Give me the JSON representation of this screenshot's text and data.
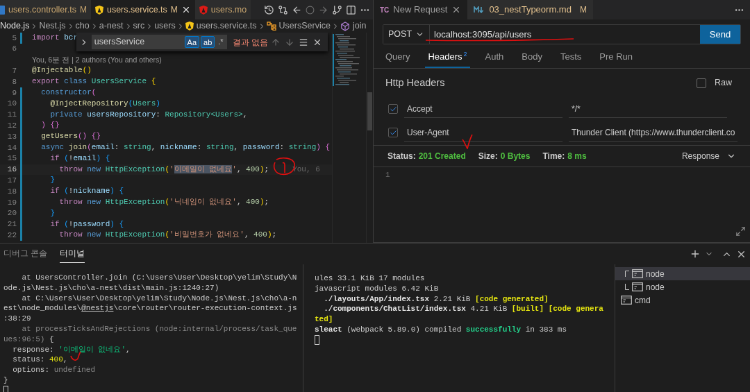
{
  "editor": {
    "tabs": [
      {
        "label": "users.controller.ts",
        "status": "M",
        "kind": "ts",
        "selected": false
      },
      {
        "label": "users.service.ts",
        "status": "M",
        "kind": "service",
        "selected": true
      },
      {
        "label": "users.mo",
        "kind": "module",
        "selected": false
      }
    ],
    "breadcrumb": [
      {
        "label": "Node.js",
        "kind": "folder"
      },
      {
        "label": "Nest.js",
        "kind": "folder"
      },
      {
        "label": "cho",
        "kind": "folder"
      },
      {
        "label": "a-nest",
        "kind": "folder"
      },
      {
        "label": "src",
        "kind": "folder"
      },
      {
        "label": "users",
        "kind": "folder"
      },
      {
        "label": "users.service.ts",
        "kind": "file"
      },
      {
        "label": "UsersService",
        "kind": "class"
      },
      {
        "label": "join",
        "kind": "method"
      }
    ],
    "find": {
      "value": "usersService",
      "toggles": [
        {
          "label": "Aa",
          "on": true
        },
        {
          "label": "ab",
          "on": true
        },
        {
          "label": ".*",
          "on": false
        }
      ],
      "result": "결과 없음"
    },
    "lines": [
      {
        "kind": "code",
        "number": "5",
        "modified": true,
        "current": false,
        "tokens": [
          {
            "text": "import ",
            "kind": "kw"
          },
          {
            "text": "bcr",
            "kind": "var"
          }
        ]
      },
      {
        "kind": "code",
        "number": "6",
        "modified": false,
        "current": false
      },
      {
        "kind": "codelens",
        "text": "You, 6분 전 | 2 authors (You and others)"
      },
      {
        "kind": "code",
        "number": "7",
        "modified": false,
        "current": false,
        "tokens": [
          {
            "text": "@Injectable",
            "kind": "fn"
          },
          {
            "text": "()",
            "kind": "b1"
          }
        ]
      },
      {
        "kind": "code",
        "number": "8",
        "modified": false,
        "current": false,
        "tokens": [
          {
            "text": "export ",
            "kind": "kw"
          },
          {
            "text": "class ",
            "kind": "storage"
          },
          {
            "text": "UsersService ",
            "kind": "type"
          },
          {
            "text": "{",
            "kind": "b1"
          }
        ]
      },
      {
        "kind": "code",
        "number": "9",
        "modified": true,
        "current": false,
        "tokens": [
          {
            "text": "  constructor",
            "kind": "storage"
          },
          {
            "text": "(",
            "kind": "b2"
          }
        ]
      },
      {
        "kind": "code",
        "number": "10",
        "modified": true,
        "current": false,
        "tokens": [
          {
            "text": "    @InjectRepository",
            "kind": "fn"
          },
          {
            "text": "(",
            "kind": "b3"
          },
          {
            "text": "Users",
            "kind": "type"
          },
          {
            "text": ")",
            "kind": "b3"
          }
        ]
      },
      {
        "kind": "code",
        "number": "11",
        "modified": true,
        "current": false,
        "tokens": [
          {
            "text": "    private ",
            "kind": "storage"
          },
          {
            "text": "usersRepository",
            "kind": "var"
          },
          {
            "text": ": ",
            "kind": "plain"
          },
          {
            "text": "Repository<Users>",
            "kind": "type"
          },
          {
            "text": ",",
            "kind": "plain"
          }
        ]
      },
      {
        "kind": "code",
        "number": "12",
        "modified": true,
        "current": false,
        "tokens": [
          {
            "text": "  ) {}",
            "kind": "b2"
          }
        ]
      },
      {
        "kind": "code",
        "number": "13",
        "modified": true,
        "current": false,
        "tokens": [
          {
            "text": "  getUsers",
            "kind": "fn"
          },
          {
            "text": "() {}",
            "kind": "b2"
          }
        ]
      },
      {
        "kind": "code",
        "number": "14",
        "modified": true,
        "current": false,
        "tokens": [
          {
            "text": "  async ",
            "kind": "storage"
          },
          {
            "text": "join",
            "kind": "fn"
          },
          {
            "text": "(",
            "kind": "b2"
          },
          {
            "text": "email",
            "kind": "var"
          },
          {
            "text": ": ",
            "kind": "plain"
          },
          {
            "text": "string",
            "kind": "type"
          },
          {
            "text": ", ",
            "kind": "plain"
          },
          {
            "text": "nickname",
            "kind": "var"
          },
          {
            "text": ": ",
            "kind": "plain"
          },
          {
            "text": "string",
            "kind": "type"
          },
          {
            "text": ", ",
            "kind": "plain"
          },
          {
            "text": "password",
            "kind": "var"
          },
          {
            "text": ": ",
            "kind": "plain"
          },
          {
            "text": "string",
            "kind": "type"
          },
          {
            "text": ") {",
            "kind": "b2"
          }
        ]
      },
      {
        "kind": "code",
        "number": "15",
        "modified": true,
        "current": false,
        "tokens": [
          {
            "text": "    if ",
            "kind": "kw"
          },
          {
            "text": "(",
            "kind": "b3"
          },
          {
            "text": "!",
            "kind": "plain"
          },
          {
            "text": "email",
            "kind": "var"
          },
          {
            "text": ") {",
            "kind": "b3"
          }
        ]
      },
      {
        "kind": "code",
        "number": "16",
        "modified": true,
        "current": true,
        "blame": "You, 6",
        "tokens": [
          {
            "text": "      throw ",
            "kind": "kw"
          },
          {
            "text": "new ",
            "kind": "storage"
          },
          {
            "text": "HttpException",
            "kind": "type"
          },
          {
            "text": "(",
            "kind": "b1"
          },
          {
            "text": "'",
            "kind": "str"
          },
          {
            "text": "이메일이 없네요",
            "kind": "match"
          },
          {
            "text": "'",
            "kind": "str"
          },
          {
            "text": ", ",
            "kind": "plain"
          },
          {
            "text": "400",
            "kind": "num"
          },
          {
            "text": ")",
            "kind": "b1"
          },
          {
            "text": ";",
            "kind": "plain"
          }
        ]
      },
      {
        "kind": "code",
        "number": "17",
        "modified": true,
        "current": false,
        "tokens": [
          {
            "text": "    }",
            "kind": "b3"
          }
        ]
      },
      {
        "kind": "code",
        "number": "18",
        "modified": true,
        "current": false,
        "tokens": [
          {
            "text": "    if ",
            "kind": "kw"
          },
          {
            "text": "(",
            "kind": "b3"
          },
          {
            "text": "!",
            "kind": "plain"
          },
          {
            "text": "nickname",
            "kind": "var"
          },
          {
            "text": ") {",
            "kind": "b3"
          }
        ]
      },
      {
        "kind": "code",
        "number": "19",
        "modified": true,
        "current": false,
        "tokens": [
          {
            "text": "      throw ",
            "kind": "kw"
          },
          {
            "text": "new ",
            "kind": "storage"
          },
          {
            "text": "HttpException",
            "kind": "type"
          },
          {
            "text": "(",
            "kind": "b1"
          },
          {
            "text": "'닉네임이 없네요'",
            "kind": "str"
          },
          {
            "text": ", ",
            "kind": "plain"
          },
          {
            "text": "400",
            "kind": "num"
          },
          {
            "text": ")",
            "kind": "b1"
          },
          {
            "text": ";",
            "kind": "plain"
          }
        ]
      },
      {
        "kind": "code",
        "number": "20",
        "modified": true,
        "current": false,
        "tokens": [
          {
            "text": "    }",
            "kind": "b3"
          }
        ]
      },
      {
        "kind": "code",
        "number": "21",
        "modified": true,
        "current": false,
        "tokens": [
          {
            "text": "    if ",
            "kind": "kw"
          },
          {
            "text": "(",
            "kind": "b3"
          },
          {
            "text": "!",
            "kind": "plain"
          },
          {
            "text": "password",
            "kind": "var"
          },
          {
            "text": ") {",
            "kind": "b3"
          }
        ]
      },
      {
        "kind": "code",
        "number": "22",
        "modified": true,
        "current": false,
        "tokens": [
          {
            "text": "      throw ",
            "kind": "kw"
          },
          {
            "text": "new ",
            "kind": "storage"
          },
          {
            "text": "HttpException",
            "kind": "type"
          },
          {
            "text": "(",
            "kind": "b1"
          },
          {
            "text": "'비밀번호가 없네요'",
            "kind": "str"
          },
          {
            "text": ", ",
            "kind": "plain"
          },
          {
            "text": "400",
            "kind": "num"
          },
          {
            "text": ")",
            "kind": "b1"
          },
          {
            "text": ";",
            "kind": "plain"
          }
        ]
      }
    ]
  },
  "client": {
    "tabs": [
      {
        "label": "New Request",
        "badge": "TC",
        "kind": "request",
        "selected": true
      },
      {
        "label": "03_nestTypeorm.md",
        "status": "M",
        "kind": "markdown",
        "selected": false
      }
    ],
    "method": "POST",
    "url": "localhost:3095/api/users",
    "send": "Send",
    "subtabs": [
      {
        "label": "Query",
        "selected": false
      },
      {
        "label": "Headers",
        "count": "2",
        "selected": true
      },
      {
        "label": "Auth",
        "selected": false
      },
      {
        "label": "Body",
        "selected": false
      },
      {
        "label": "Tests",
        "selected": false
      },
      {
        "label": "Pre Run",
        "selected": false
      }
    ],
    "headers_title": "Http Headers",
    "raw": {
      "label": "Raw",
      "checked": false
    },
    "headers": [
      {
        "name": "Accept",
        "value": "*/*",
        "checked": true
      },
      {
        "name": "User-Agent",
        "value": "Thunder Client (https://www.thunderclient.co",
        "checked": true
      }
    ],
    "status": [
      {
        "label": "Status:",
        "value": "201 Created"
      },
      {
        "label": "Size:",
        "value": "0 Bytes"
      },
      {
        "label": "Time:",
        "value": "8 ms"
      }
    ],
    "view": "Response",
    "response_lines": [
      "1"
    ]
  },
  "panel": {
    "tabs": [
      {
        "label": "디버그 콘솔",
        "selected": false
      },
      {
        "label": "터미널",
        "selected": true
      }
    ],
    "left_terminal": [
      {
        "tokens": [
          {
            "text": "    at UsersController.join (C:\\Users\\User\\Desktop\\yelim\\Study\\N",
            "kind": "plain"
          }
        ]
      },
      {
        "tokens": [
          {
            "text": "ode.js\\Nest.js\\cho\\a-nest\\dist\\main.js:1240:27)",
            "kind": "plain"
          }
        ]
      },
      {
        "tokens": [
          {
            "text": "    at C:\\Users\\User\\Desktop\\yelim\\Study\\Node.js\\Nest.js\\cho\\a-n",
            "kind": "plain"
          }
        ]
      },
      {
        "tokens": [
          {
            "text": "est\\node_modules\\",
            "kind": "plain"
          },
          {
            "text": "@nestjs",
            "kind": "link"
          },
          {
            "text": "\\core\\router\\router-execution-context.js",
            "kind": "plain"
          }
        ]
      },
      {
        "tokens": [
          {
            "text": ":38:29",
            "kind": "plain"
          }
        ]
      },
      {
        "tokens": [
          {
            "text": "    at processTicksAndRejections (node:internal/process/task_que",
            "kind": "dim"
          }
        ]
      },
      {
        "tokens": [
          {
            "text": "ues:96:5) ",
            "kind": "dim"
          },
          {
            "text": "{",
            "kind": "plain"
          }
        ]
      },
      {
        "tokens": [
          {
            "text": "  response: ",
            "kind": "plain"
          },
          {
            "text": "'이메일이 없네요'",
            "kind": "str"
          },
          {
            "text": ",",
            "kind": "plain"
          }
        ]
      },
      {
        "tokens": [
          {
            "text": "  status: ",
            "kind": "plain"
          },
          {
            "text": "400",
            "kind": "num"
          },
          {
            "text": ",",
            "kind": "plain"
          }
        ]
      },
      {
        "tokens": [
          {
            "text": "  options: ",
            "kind": "plain"
          },
          {
            "text": "undefined",
            "kind": "dim"
          }
        ]
      },
      {
        "tokens": [
          {
            "text": "}",
            "kind": "plain"
          }
        ]
      }
    ],
    "right_terminal": [
      {
        "tokens": [
          {
            "text": "ules 33.1 KiB 17 modules",
            "kind": "plain"
          }
        ]
      },
      {
        "tokens": [
          {
            "text": "javascript modules 6.42 KiB",
            "kind": "plain"
          }
        ]
      },
      {
        "tokens": [
          {
            "text": "  ./layouts/App/index.tsx",
            "kind": "bold"
          },
          {
            "text": " 2.21 KiB ",
            "kind": "plain"
          },
          {
            "text": "[code generated]",
            "kind": "ybold"
          }
        ]
      },
      {
        "tokens": [
          {
            "text": "  ./components/ChatList/index.tsx",
            "kind": "bold"
          },
          {
            "text": " 4.21 KiB ",
            "kind": "plain"
          },
          {
            "text": "[built] [code genera",
            "kind": "ybold"
          }
        ]
      },
      {
        "tokens": [
          {
            "text": "ted]",
            "kind": "ybold"
          }
        ]
      },
      {
        "tokens": [
          {
            "text": "sleact",
            "kind": "bold"
          },
          {
            "text": " (webpack 5.89.0) compiled ",
            "kind": "plain"
          },
          {
            "text": "successfully",
            "kind": "gbold"
          },
          {
            "text": " in 383 ms",
            "kind": "plain"
          }
        ]
      }
    ],
    "terminals": [
      {
        "children": [
          {
            "label": "node",
            "selected": true
          },
          {
            "label": "node",
            "selected": false
          }
        ]
      },
      {
        "label": "cmd",
        "selected": false
      }
    ]
  }
}
